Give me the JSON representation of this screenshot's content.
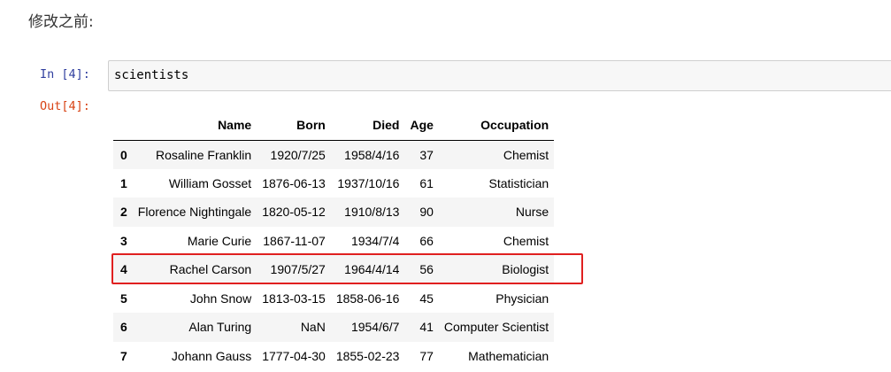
{
  "heading": "修改之前:",
  "input_prompt": "In [4]:",
  "output_prompt": "Out[4]:",
  "code": "scientists",
  "table": {
    "columns": [
      "",
      "Name",
      "Born",
      "Died",
      "Age",
      "Occupation"
    ],
    "rows": [
      {
        "index": "0",
        "Name": "Rosaline Franklin",
        "Born": "1920/7/25",
        "Died": "1958/4/16",
        "Age": "37",
        "Occupation": "Chemist"
      },
      {
        "index": "1",
        "Name": "William Gosset",
        "Born": "1876-06-13",
        "Died": "1937/10/16",
        "Age": "61",
        "Occupation": "Statistician"
      },
      {
        "index": "2",
        "Name": "Florence Nightingale",
        "Born": "1820-05-12",
        "Died": "1910/8/13",
        "Age": "90",
        "Occupation": "Nurse"
      },
      {
        "index": "3",
        "Name": "Marie Curie",
        "Born": "1867-11-07",
        "Died": "1934/7/4",
        "Age": "66",
        "Occupation": "Chemist"
      },
      {
        "index": "4",
        "Name": "Rachel Carson",
        "Born": "1907/5/27",
        "Died": "1964/4/14",
        "Age": "56",
        "Occupation": "Biologist"
      },
      {
        "index": "5",
        "Name": "John Snow",
        "Born": "1813-03-15",
        "Died": "1858-06-16",
        "Age": "45",
        "Occupation": "Physician"
      },
      {
        "index": "6",
        "Name": "Alan Turing",
        "Born": "NaN",
        "Died": "1954/6/7",
        "Age": "41",
        "Occupation": "Computer Scientist"
      },
      {
        "index": "7",
        "Name": "Johann Gauss",
        "Born": "1777-04-30",
        "Died": "1855-02-23",
        "Age": "77",
        "Occupation": "Mathematician"
      }
    ]
  },
  "colors": {
    "input_prompt": "#303f9f",
    "output_prompt": "#d84315",
    "highlight": "#e02020"
  }
}
